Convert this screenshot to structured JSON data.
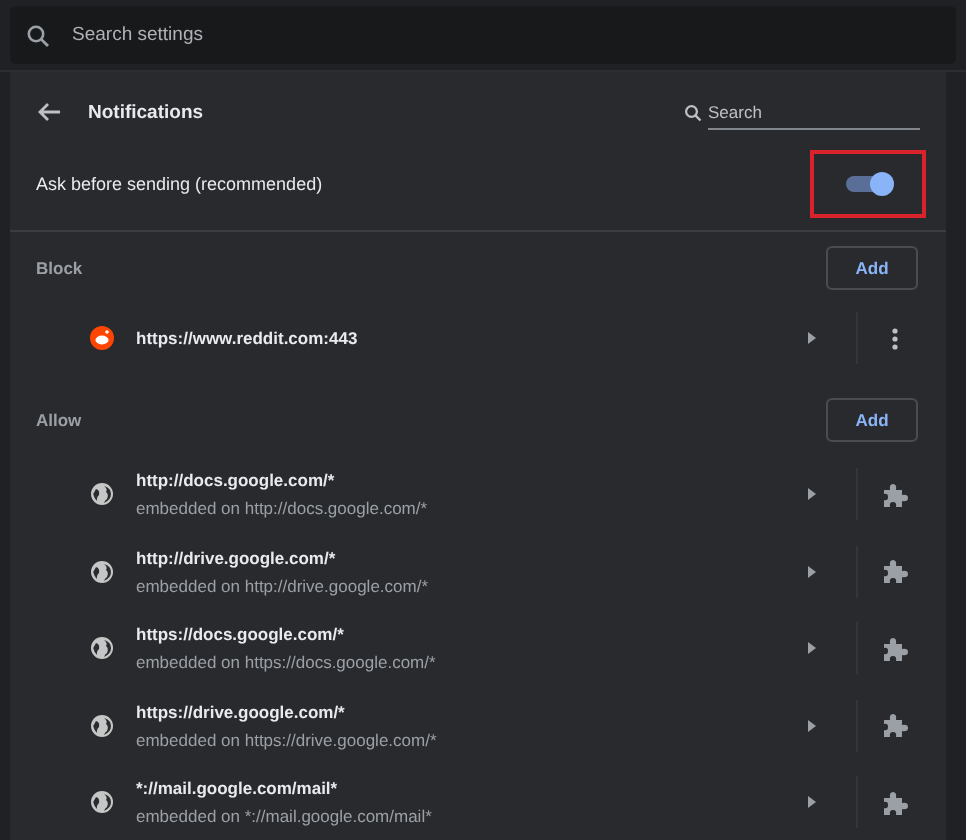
{
  "top_search": {
    "placeholder": "Search settings"
  },
  "page": {
    "title": "Notifications",
    "search_placeholder": "Search"
  },
  "ask_setting": {
    "label": "Ask before sending (recommended)",
    "on": true,
    "highlighted": true
  },
  "sections": [
    {
      "label": "Block",
      "kind": "block",
      "add_button": "Add",
      "sites": [
        {
          "url": "https://www.reddit.com:443",
          "kind": "reddit"
        }
      ]
    },
    {
      "label": "Allow",
      "kind": "allow",
      "add_button": "Add",
      "sites": [
        {
          "url": "http://docs.google.com/*",
          "subtitle": "embedded on http://docs.google.com/*",
          "kind": "globe"
        },
        {
          "url": "http://drive.google.com/*",
          "subtitle": "embedded on http://drive.google.com/*",
          "kind": "globe"
        },
        {
          "url": "https://docs.google.com/*",
          "subtitle": "embedded on https://docs.google.com/*",
          "kind": "globe"
        },
        {
          "url": "https://drive.google.com/*",
          "subtitle": "embedded on https://drive.google.com/*",
          "kind": "globe"
        },
        {
          "url": "*://mail.google.com/mail*",
          "subtitle": "embedded on *://mail.google.com/mail*",
          "kind": "globe"
        }
      ]
    }
  ]
}
